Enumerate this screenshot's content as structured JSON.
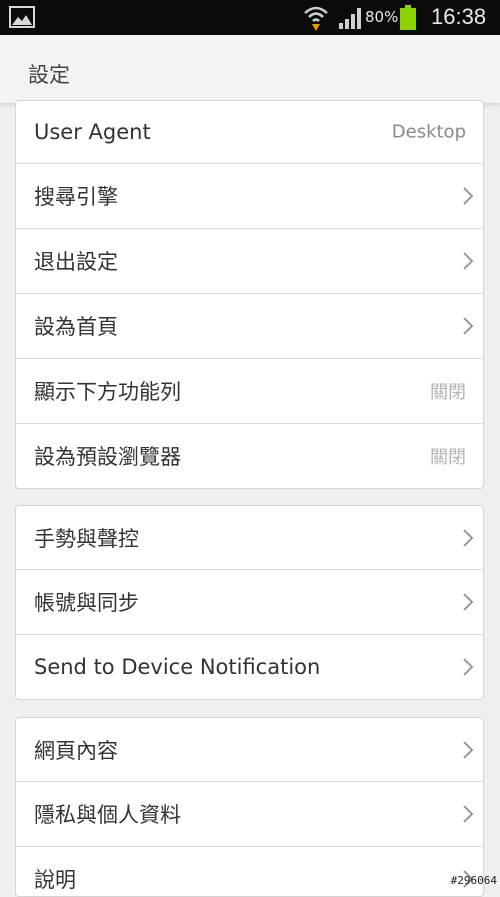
{
  "status_bar": {
    "battery_percent": "80%",
    "time": "16:38",
    "icons": [
      "gallery-icon",
      "wifi-icon",
      "signal-icon",
      "battery-icon"
    ],
    "battery_color": "#8bd300"
  },
  "action_bar": {
    "title": "設定"
  },
  "groups": [
    {
      "items": [
        {
          "label": "User Agent",
          "value": "Desktop"
        },
        {
          "label": "搜尋引擎",
          "chevron": true
        },
        {
          "label": "退出設定",
          "chevron": true
        },
        {
          "label": "設為首頁",
          "chevron": true
        },
        {
          "label": "顯示下方功能列",
          "value": "關閉"
        },
        {
          "label": "設為預設瀏覽器",
          "value": "關閉"
        }
      ]
    },
    {
      "items": [
        {
          "label": "手勢與聲控",
          "chevron": true
        },
        {
          "label": "帳號與同步",
          "chevron": true
        },
        {
          "label": "Send to Device Notification",
          "chevron": true
        }
      ]
    },
    {
      "items": [
        {
          "label": "網頁內容",
          "chevron": true
        },
        {
          "label": "隱私與個人資料",
          "chevron": true
        },
        {
          "label": "說明",
          "chevron": true
        }
      ]
    }
  ],
  "watermark": "#296064"
}
